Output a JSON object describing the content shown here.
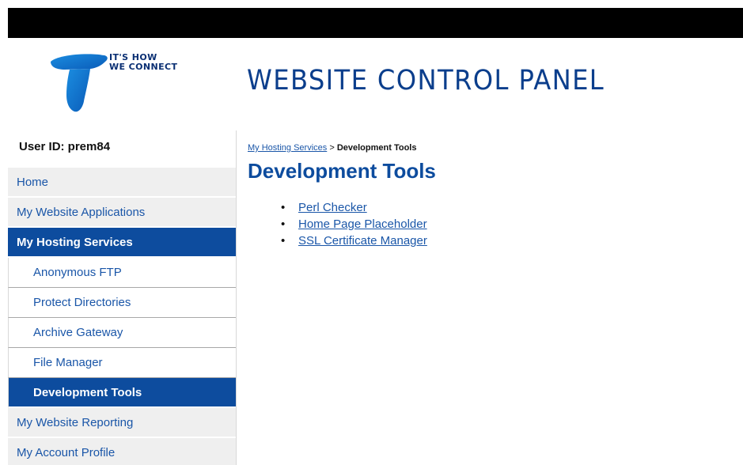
{
  "header": {
    "tagline_line1": "IT'S HOW",
    "tagline_line2": "WE CONNECT",
    "title": "WEBSITE CONTROL PANEL",
    "logo_icon": "telstra-t-logo-icon"
  },
  "sidebar": {
    "user_id": "User ID: prem84",
    "items": [
      {
        "label": "Home",
        "level": "top",
        "active": false
      },
      {
        "label": "My Website Applications",
        "level": "top",
        "active": false
      },
      {
        "label": "My Hosting Services",
        "level": "top",
        "active": true
      },
      {
        "label": "Anonymous FTP",
        "level": "sub",
        "active": false
      },
      {
        "label": "Protect Directories",
        "level": "sub",
        "active": false
      },
      {
        "label": "Archive Gateway",
        "level": "sub",
        "active": false
      },
      {
        "label": "File Manager",
        "level": "sub",
        "active": false
      },
      {
        "label": "Development Tools",
        "level": "sub",
        "active": true
      },
      {
        "label": "My Website Reporting",
        "level": "top",
        "active": false
      },
      {
        "label": "My Account Profile",
        "level": "top",
        "active": false
      }
    ]
  },
  "main": {
    "breadcrumb": {
      "parent": "My Hosting Services",
      "separator": " > ",
      "current": "Development Tools"
    },
    "heading": "Development Tools",
    "tools": [
      {
        "label": "Perl Checker"
      },
      {
        "label": "Home Page Placeholder"
      },
      {
        "label": "SSL Certificate Manager"
      }
    ]
  },
  "colors": {
    "brand_blue": "#0d4c9e",
    "link_blue": "#1a56a8",
    "nav_bg": "#efefef",
    "top_bar": "#000000"
  }
}
